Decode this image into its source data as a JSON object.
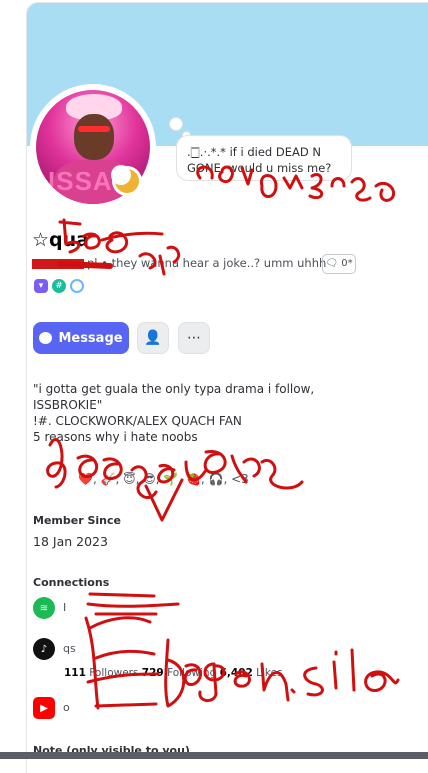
{
  "profile": {
    "name": "☆qua",
    "tagline": "pl • they wanna hear a joke..? umm uhhh",
    "status_bubble": ".🀆.·.*.* if i died DEAD N GONE, would u miss me?",
    "pronoun_label": "🗨 0*",
    "bio_line1": "\"i gotta get guala the only typa drama i follow,",
    "bio_line2": "ISSBROKIE\"",
    "bio_line3": "!#. CLOCKWORK/ALEX QUACH FAN",
    "bio_line4": "5 reasons why i hate noobs",
    "emoji_line": "❤️, 🎸, 😇, 😎, 🌱, 🍓, 🎧, <3",
    "avatar_text": "ISSA"
  },
  "actions": {
    "message_label": "Message"
  },
  "member_since": {
    "label": "Member Since",
    "value": "18 Jan 2023"
  },
  "connections": {
    "label": "Connections",
    "items": [
      {
        "service": "spotify",
        "text": "I"
      },
      {
        "service": "tiktok",
        "text": "qs"
      },
      {
        "service": "youtube",
        "text": "o"
      }
    ],
    "tiktok_stats": {
      "followers_count": "111",
      "followers_label": "Followers",
      "following_count": "729",
      "following_label": "Following",
      "likes_count": "6,402",
      "likes_label": "Likes"
    }
  },
  "note_label": "Note (only visible to you)",
  "annotations": {
    "scribble1": "con ouzu",
    "scribble2": "gen",
    "scribble3": "booger",
    "scribble4": "booger.sile"
  },
  "colors": {
    "banner": "#a8ddf4",
    "accent": "#5865f2",
    "scribble": "#d01010"
  }
}
